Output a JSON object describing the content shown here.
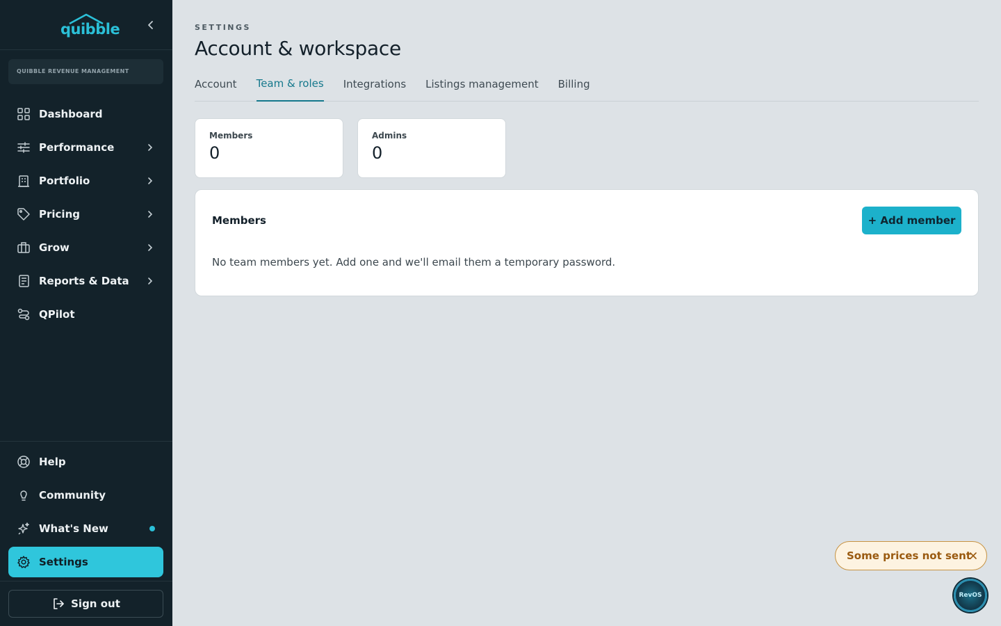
{
  "brand": {
    "logo_text": "quibble"
  },
  "org": {
    "name": "QUIBBLE REVENUE MANAGEMENT"
  },
  "nav": {
    "items": [
      {
        "label": "Dashboard"
      },
      {
        "label": "Performance"
      },
      {
        "label": "Portfolio"
      },
      {
        "label": "Pricing"
      },
      {
        "label": "Grow"
      },
      {
        "label": "Reports & Data"
      },
      {
        "label": "QPilot"
      }
    ],
    "bottom": [
      {
        "label": "Help"
      },
      {
        "label": "Community"
      },
      {
        "label": "What's New"
      },
      {
        "label": "Settings"
      }
    ],
    "signout": "Sign out"
  },
  "header": {
    "eyebrow": "SETTINGS",
    "title": "Account & workspace"
  },
  "tabs": [
    {
      "label": "Account"
    },
    {
      "label": "Team & roles"
    },
    {
      "label": "Integrations"
    },
    {
      "label": "Listings management"
    },
    {
      "label": "Billing"
    }
  ],
  "stats": [
    {
      "label": "Members",
      "value": "0"
    },
    {
      "label": "Admins",
      "value": "0"
    }
  ],
  "members_card": {
    "title": "Members",
    "add_label": "+ Add member",
    "empty_text": "No team members yet. Add one and we'll email them a temporary password."
  },
  "toast": {
    "text": "Some prices not sent"
  },
  "fab": {
    "label": "RevOS"
  },
  "colors": {
    "accent": "#2fc6dc",
    "sidebar": "#13222a",
    "warning": "#9a5a10"
  }
}
